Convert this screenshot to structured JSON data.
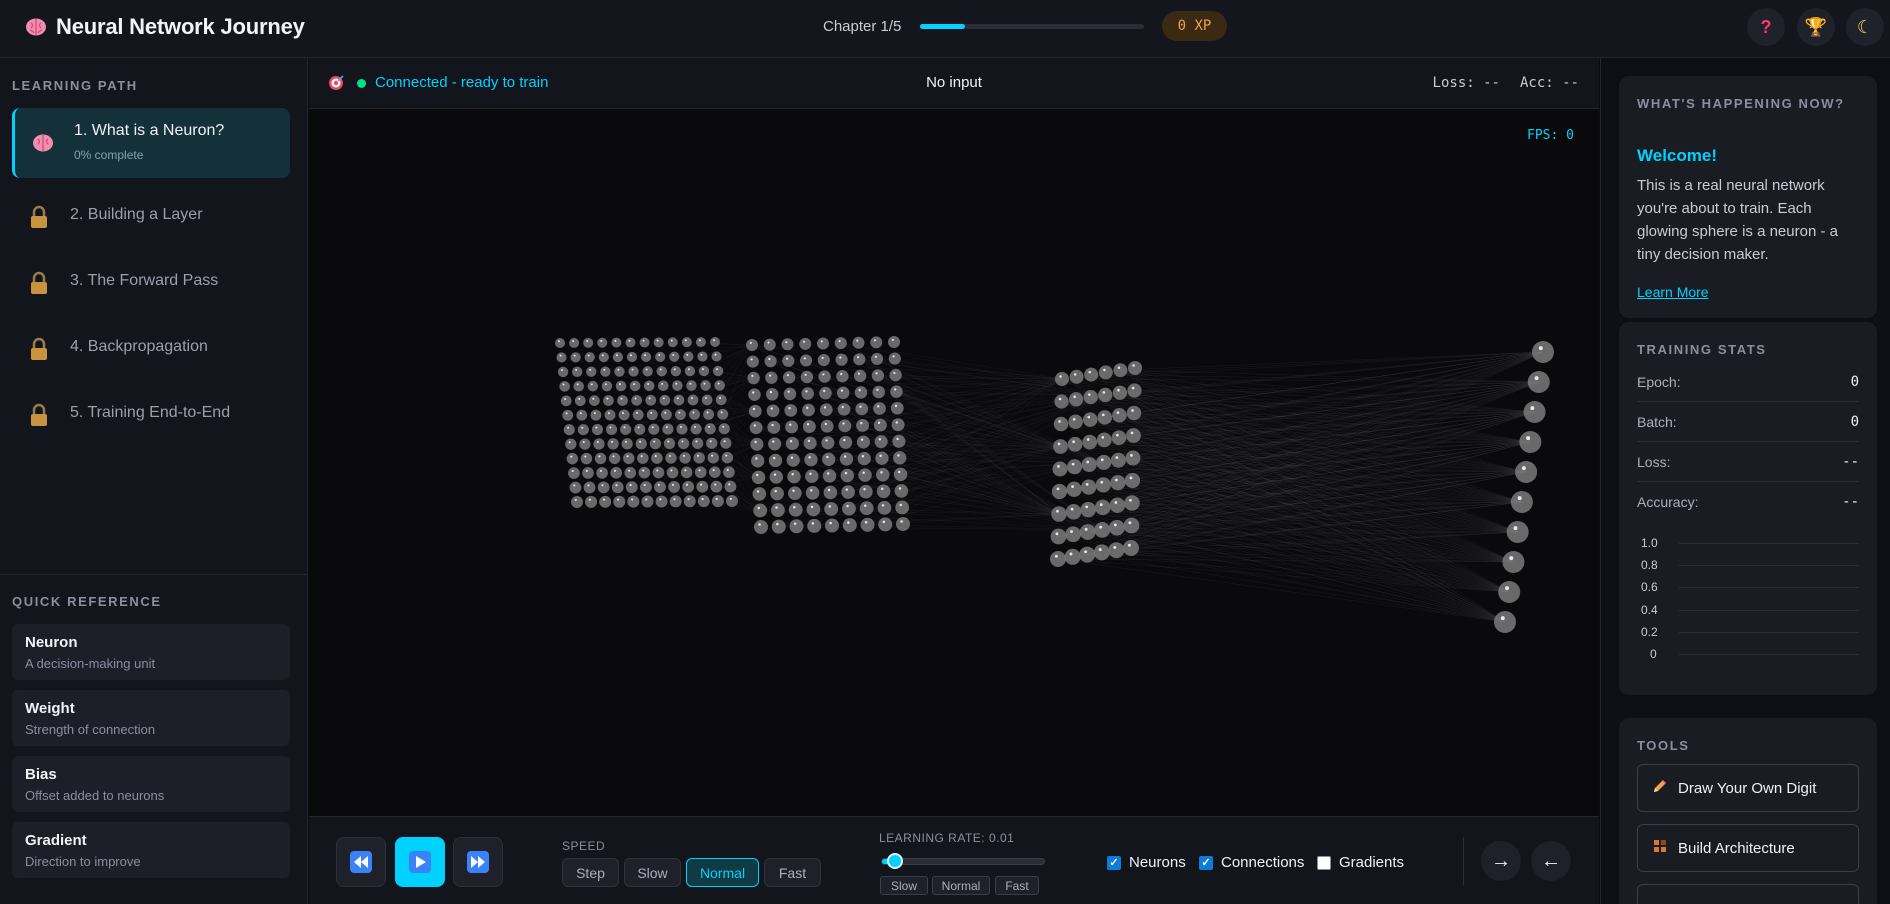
{
  "header": {
    "app_title": "Neural Network Journey",
    "chapter_label": "Chapter 1/5",
    "chapter_progress": 0.2,
    "xp": "0 XP",
    "help_icon": "question-icon",
    "trophy_icon": "trophy-icon",
    "theme_icon": "moon-icon"
  },
  "sidebar": {
    "learning_path_title": "LEARNING PATH",
    "lessons": [
      {
        "label": "1. What is a Neuron?",
        "sub": "0% complete",
        "icon": "brain-icon",
        "state": "active"
      },
      {
        "label": "2. Building a Layer",
        "icon": "lock-icon",
        "state": "locked"
      },
      {
        "label": "3. The Forward Pass",
        "icon": "lock-icon",
        "state": "locked"
      },
      {
        "label": "4. Backpropagation",
        "icon": "lock-icon",
        "state": "locked"
      },
      {
        "label": "5. Training End-to-End",
        "icon": "lock-icon",
        "state": "locked"
      }
    ],
    "quick_reference_title": "QUICK REFERENCE",
    "references": [
      {
        "term": "Neuron",
        "desc": "A decision-making unit"
      },
      {
        "term": "Weight",
        "desc": "Strength of connection"
      },
      {
        "term": "Bias",
        "desc": "Offset added to neurons"
      },
      {
        "term": "Gradient",
        "desc": "Direction to improve"
      }
    ]
  },
  "topbar": {
    "status": "Connected - ready to train",
    "input": "No input",
    "loss": "Loss: --",
    "acc": "Acc: --"
  },
  "viz": {
    "fps": "FPS: 0",
    "neuron_color": "#7a7a7a",
    "connection_color": "#6b6b6b"
  },
  "controls": {
    "speed_label": "SPEED",
    "speed_options": [
      "Step",
      "Slow",
      "Normal",
      "Fast"
    ],
    "speed_selected": "Normal",
    "learning_rate_label": "LEARNING RATE: 0.01",
    "learning_rate_fraction": 0.05,
    "lr_presets": [
      "Slow",
      "Normal",
      "Fast"
    ],
    "toggles": [
      {
        "label": "Neurons",
        "checked": true
      },
      {
        "label": "Connections",
        "checked": true
      },
      {
        "label": "Gradients",
        "checked": false
      }
    ],
    "next_icon": "arrow-right-icon",
    "prev_icon": "arrow-left-icon"
  },
  "right_panel": {
    "happening_title": "WHAT'S HAPPENING NOW?",
    "welcome_title": "Welcome!",
    "welcome_body": "This is a real neural network you're about to train. Each glowing sphere is a neuron - a tiny decision maker.",
    "learn_more": "Learn More",
    "stats_title": "TRAINING STATS",
    "stats": [
      {
        "label": "Epoch:",
        "value": "0"
      },
      {
        "label": "Batch:",
        "value": "0"
      },
      {
        "label": "Loss:",
        "value": "--"
      },
      {
        "label": "Accuracy:",
        "value": "--"
      }
    ],
    "chart_yticks": [
      "1.0",
      "0.8",
      "0.6",
      "0.4",
      "0.2",
      "0"
    ],
    "tools_title": "TOOLS",
    "tools": [
      {
        "label": "Draw Your Own Digit",
        "icon": "pencil-icon"
      },
      {
        "label": "Build Architecture",
        "icon": "blocks-icon"
      }
    ]
  },
  "colors": {
    "accent": "#00d2ff",
    "connected_dot": "#00e08a",
    "xp": "#f0a24a",
    "background": "#0a0a0d"
  }
}
